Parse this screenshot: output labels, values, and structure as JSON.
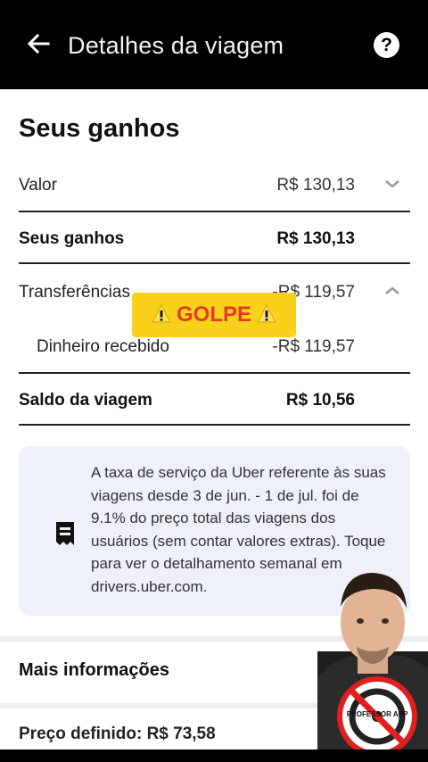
{
  "header": {
    "back_icon": "arrow-left-icon",
    "title": "Detalhes da viagem",
    "help_icon": "question-mark-icon",
    "help_glyph": "?"
  },
  "earnings": {
    "heading": "Seus ganhos",
    "rows": [
      {
        "label": "Valor",
        "value": "R$ 130,13",
        "chevron": "chevron-down-icon"
      },
      {
        "label": "Seus ganhos",
        "value": "R$ 130,13"
      },
      {
        "label": "Transferências",
        "value": "-R$ 119,57",
        "chevron": "chevron-up-icon"
      },
      {
        "label": "Dinheiro recebido",
        "value": "-R$ 119,57"
      },
      {
        "label": "Saldo da viagem",
        "value": "R$ 10,56"
      }
    ]
  },
  "info": {
    "icon": "receipt-icon",
    "text": "A taxa de serviço da Uber referente às suas viagens desde 3 de jun. - 1 de jul. foi de 9.1% do preço total das viagens dos usuários (sem contar valores extras). Toque para ver o detalhamento semanal em drivers.uber.com."
  },
  "more_info": {
    "heading": "Mais informações",
    "price_line": "Preço definido: R$ 73,58"
  },
  "overlay": {
    "label": "GOLPE",
    "warning_icon": "warning-icon",
    "badge_text": "PROFESSOR APP",
    "colors": {
      "badge_bg": "#f8d21a",
      "badge_text": "#e23b23"
    }
  }
}
